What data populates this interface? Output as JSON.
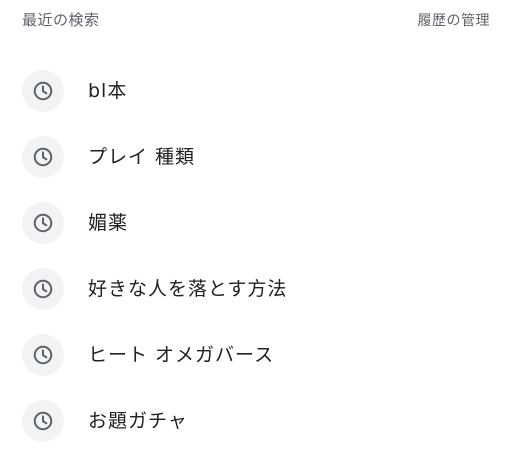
{
  "header": {
    "title": "最近の検索",
    "manage_label": "履歴の管理"
  },
  "recent_searches": [
    {
      "label": "bl本",
      "icon": "history-clock-icon"
    },
    {
      "label": "プレイ 種類",
      "icon": "history-clock-icon"
    },
    {
      "label": "媚薬",
      "icon": "history-clock-icon"
    },
    {
      "label": "好きな人を落とす方法",
      "icon": "history-clock-icon"
    },
    {
      "label": "ヒート オメガバース",
      "icon": "history-clock-icon"
    },
    {
      "label": "お題ガチャ",
      "icon": "history-clock-icon"
    }
  ],
  "colors": {
    "icon_bg": "#f1f3f4",
    "icon_stroke": "#5f6368",
    "text": "#202124",
    "muted": "#5f6368"
  }
}
